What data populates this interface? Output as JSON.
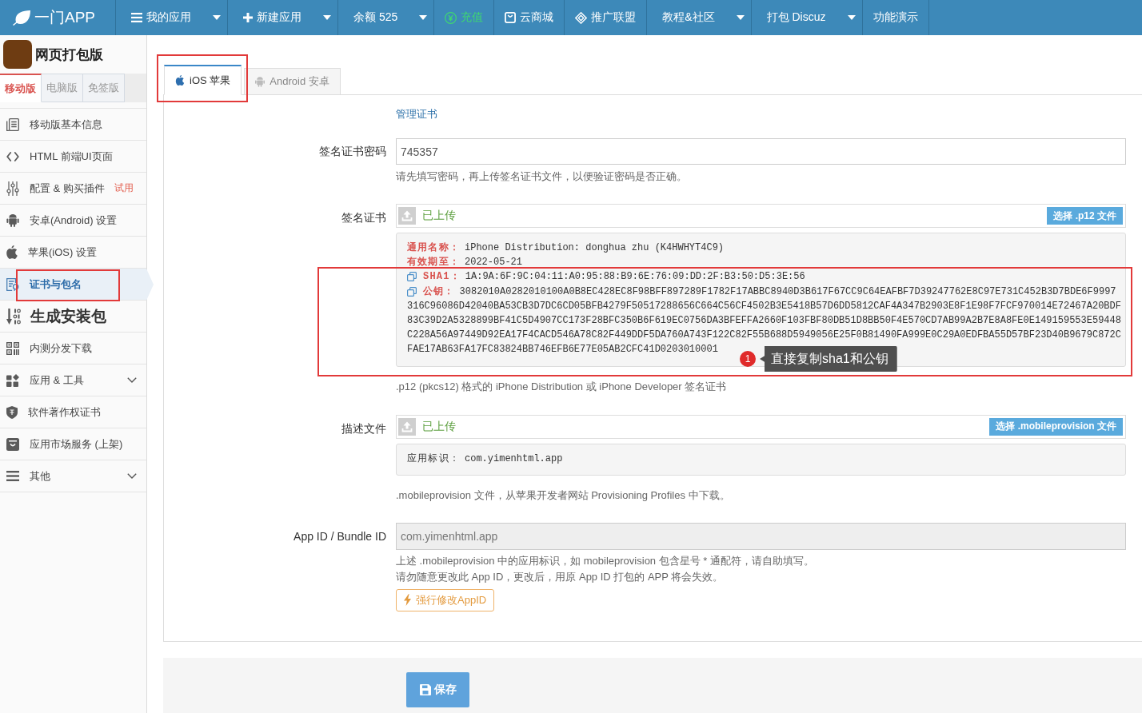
{
  "top_nav": {
    "logo": "一门APP",
    "items": [
      {
        "label": "我的应用",
        "dropdown": true,
        "highlight": false
      },
      {
        "label": "新建应用",
        "dropdown": true,
        "highlight": false
      },
      {
        "label": "余额 525",
        "dropdown": true,
        "highlight": false
      },
      {
        "label": "充值",
        "dropdown": false,
        "highlight": true
      },
      {
        "label": "云商城",
        "dropdown": false,
        "highlight": false
      },
      {
        "label": "推广联盟",
        "dropdown": false,
        "highlight": false
      },
      {
        "label": "教程&社区",
        "dropdown": true,
        "highlight": false
      },
      {
        "label": "打包 Discuz",
        "dropdown": true,
        "highlight": false
      },
      {
        "label": "功能演示",
        "dropdown": false,
        "highlight": false
      }
    ]
  },
  "sidebar": {
    "app_name": "网页打包版",
    "tabs": [
      {
        "label": "移动版",
        "selected": true
      },
      {
        "label": "电脑版",
        "selected": false
      },
      {
        "label": "免签版",
        "selected": false
      }
    ],
    "items": [
      {
        "label": "移动版基本信息",
        "kind": "link",
        "selected": false,
        "highlighted": false
      },
      {
        "label": "HTML 前端UI页面",
        "kind": "link",
        "selected": false,
        "highlighted": false
      },
      {
        "label": "配置 & 购买插件",
        "kind": "link",
        "badge": "试用",
        "selected": false,
        "highlighted": false
      },
      {
        "label": "安卓(Android) 设置",
        "kind": "link",
        "selected": false,
        "highlighted": false
      },
      {
        "label": "苹果(iOS) 设置",
        "kind": "link",
        "selected": false,
        "highlighted": false
      },
      {
        "label": "证书与包名",
        "kind": "link",
        "selected": true,
        "highlighted": true
      },
      {
        "label": "生成安装包",
        "kind": "heading",
        "selected": false,
        "highlighted": false
      },
      {
        "label": "内测分发下载",
        "kind": "link",
        "selected": false,
        "highlighted": false
      },
      {
        "label": "应用 & 工具",
        "kind": "group",
        "selected": false,
        "highlighted": false
      },
      {
        "label": "软件著作权证书",
        "kind": "link",
        "selected": false,
        "highlighted": false
      },
      {
        "label": "应用市场服务 (上架)",
        "kind": "link",
        "selected": false,
        "highlighted": false
      },
      {
        "label": "其他",
        "kind": "group",
        "selected": false,
        "highlighted": false
      }
    ]
  },
  "platform_tabs": [
    {
      "label": "iOS 苹果",
      "selected": true,
      "highlighted": true
    },
    {
      "label": "Android 安卓",
      "selected": false,
      "highlighted": false
    }
  ],
  "form": {
    "manage_link": "管理证书",
    "password": {
      "label": "签名证书密码",
      "value": "745357",
      "disabled": false,
      "help": "请先填写密码，再上传签名证书文件，以便验证密码是否正确。"
    },
    "certificate": {
      "label": "签名证书",
      "status": "已上传",
      "button": "选择 .p12 文件",
      "details": [
        {
          "label": "通用名称：",
          "value": "iPhone Distribution: donghua zhu (K4HWHYT4C9)",
          "kind": "field",
          "highlighted": false
        },
        {
          "label": "有效期至：",
          "value": "2022-05-21",
          "kind": "field",
          "highlighted": false
        },
        {
          "label": "SHA1：",
          "value": "1A:9A:6F:9C:04:11:A0:95:88:B9:6E:76:09:DD:2F:B3:50:D5:3E:56",
          "kind": "copy",
          "highlighted": true
        },
        {
          "label": "公钥：",
          "lines": [
            "3082010A0282010100A0B8EC428EC8F98BFF897289F1782F17ABBC8940D3B617F67CC9C64EAFBF7D39247762E8C97E731C452B3D7BDE6F9997",
            "316C96086D42040BA53CB3D7DC6CD05BFB4279F50517288656C664C56CF4502B3E5418B57D6DD5812CAF4A347B2903E8F1E98F7FCF970014E72467A20BDF",
            "83C39D2A5328899BF41C5D4907CC173F28BFC350B6F619EC0756DA3BFEFFA2660F103FBF80DB51D8BB50F4E570CD7AB99A2B7E8A8FE0E149159553E59448",
            "C228A56A97449D92EA17F4CACD546A78C82F449DDF5DA760A743F122C82F55B688D5949056E25F0B81490FA999E0C29A0EDFBA55D57BF23D40B9679C872C",
            "FAE17AB63FA17FC83824BB746EFB6E77E05AB2CFC41D0203010001"
          ],
          "kind": "copy",
          "highlighted": true
        }
      ],
      "annotation": {
        "number": "1",
        "text": "直接复制sha1和公钥"
      },
      "help": ".p12 (pkcs12) 格式的 iPhone Distribution 或 iPhone Developer 签名证书"
    },
    "profile": {
      "label": "描述文件",
      "status": "已上传",
      "button": "选择 .mobileprovision 文件",
      "details": [
        {
          "label": "应用标识：",
          "value": "com.yimenhtml.app",
          "kind": "plain",
          "highlighted": false
        }
      ],
      "help": ".mobileprovision 文件，从苹果开发者网站 Provisioning Profiles 中下载。"
    },
    "app_id": {
      "label": "App ID / Bundle ID",
      "value": "com.yimenhtml.app",
      "disabled": true,
      "help": [
        "上述 .mobileprovision 中的应用标识，如 mobileprovision 包含星号 * 通配符，请自助填写。",
        "请勿随意更改此 App ID，更改后，用原 App ID 打包的 APP 将会失效。"
      ],
      "button": "强行修改AppID"
    }
  },
  "footer": {
    "save_button": "保存"
  }
}
